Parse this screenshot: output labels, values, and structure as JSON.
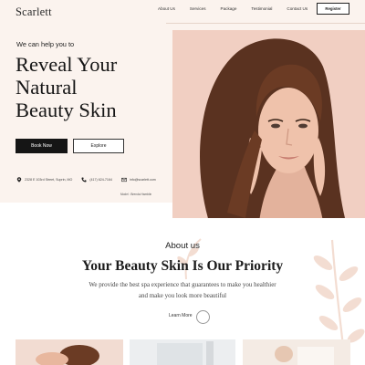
{
  "brand": {
    "name": "Scarlett"
  },
  "nav": {
    "items": [
      {
        "label": "About Us"
      },
      {
        "label": "Services"
      },
      {
        "label": "Package"
      },
      {
        "label": "Testimonial"
      },
      {
        "label": "Contact Us"
      }
    ],
    "register_label": "Register"
  },
  "hero": {
    "eyebrow": "We can help you to",
    "headline_lines": [
      "Reveal Your",
      "Natural",
      "Beauty Skin"
    ],
    "book_label": "Book Now",
    "explore_label": "Explore",
    "contact": {
      "address": "2328 E 103rd Street, Suprin, MO",
      "phone": "(417) 624-7164",
      "email": "info@scarlett.com"
    },
    "photo_credit": "Model : Brenda Hamblin"
  },
  "about": {
    "label": "About us",
    "title": "Your Beauty Skin Is Our Priority",
    "text_lines": [
      "We provide the best spa experience that guarantees to make you healthier",
      "and make you look more beautiful"
    ],
    "learn_more": "Learn More"
  },
  "colors": {
    "hero_bg": "#fbf3ee",
    "photo_bg": "#f1cfc2",
    "accent_leaf": "#f3ddd2",
    "dark": "#151515"
  }
}
